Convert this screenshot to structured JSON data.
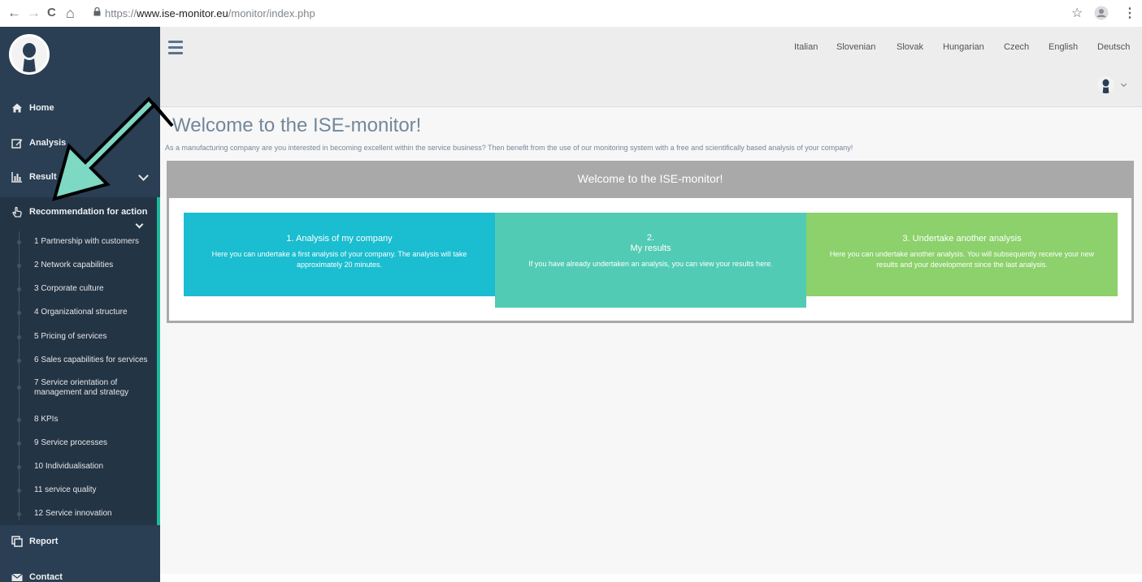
{
  "browser": {
    "url_scheme": "https://",
    "url_domain": "www.ise-monitor.eu",
    "url_path": "/monitor/index.php",
    "back_icon": "←",
    "forward_icon": "→",
    "reload_icon": "C",
    "home_icon": "⌂",
    "star_icon": "☆",
    "menu_icon": "⋮"
  },
  "sidebar": {
    "items": [
      {
        "label": "Home",
        "icon": "home-icon"
      },
      {
        "label": "Analysis",
        "icon": "edit-icon"
      },
      {
        "label": "Result",
        "icon": "bar-chart-icon"
      },
      {
        "label": "Recommendation for action",
        "icon": "hand-pointer-icon"
      },
      {
        "label": "Report",
        "icon": "clone-icon"
      },
      {
        "label": "Contact",
        "icon": "envelope-icon"
      }
    ],
    "sub_items": [
      "1 Partnership with customers",
      "2 Network capabilities",
      "3 Corporate culture",
      "4 Organizational structure",
      "5 Pricing of services",
      "6 Sales capabilities for services",
      "7 Service orientation of management and strategy",
      "8 KPIs",
      "9 Service processes",
      "10 Individualisation",
      "11 service quality",
      "12 Service innovation"
    ]
  },
  "header": {
    "languages": [
      "Italian",
      "Slovenian",
      "Slovak",
      "Hungarian",
      "Czech",
      "English",
      "Deutsch"
    ]
  },
  "main": {
    "title": "Welcome to the ISE-monitor!",
    "subtitle": "As a manufacturing company are you interested in becoming excellent within the service business? Then benefit from the use of our monitoring system with a free and scientifically based analysis of your company!",
    "panel_title": "Welcome to the ISE-monitor!",
    "tiles": [
      {
        "title": "1. Analysis of my company",
        "text": "Here you can undertake a first analysis of your company. The analysis will take approximately 20 minutes."
      },
      {
        "title_line1": "2.",
        "title_line2": "My results",
        "text": "If you have already undertaken an analysis, you can view your results here."
      },
      {
        "title": "3. Undertake another analysis",
        "text": "Here you can undertake another analysis. You will subsequently receive your new results and your development since the last analysis."
      }
    ]
  },
  "colors": {
    "sidebar_bg": "#2a3f54",
    "active_accent": "#1abb9c",
    "tile1": "#1bbdd0",
    "tile2": "#52cbb5",
    "tile3": "#8cd16b",
    "arrow_fill": "#7dd8c4"
  }
}
